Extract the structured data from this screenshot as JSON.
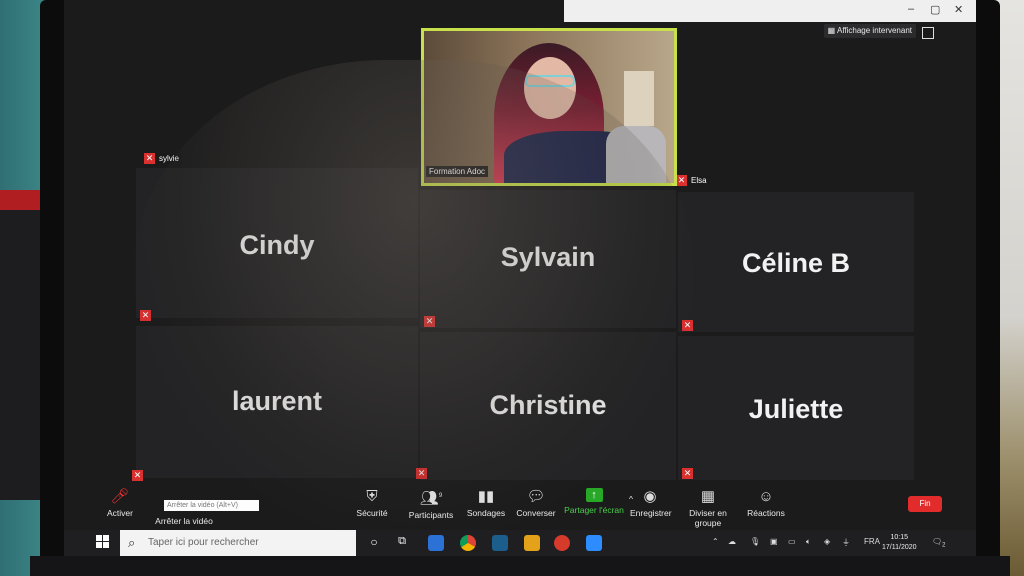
{
  "window": {
    "speaker_view_label": "Affichage intervenant",
    "controls": [
      "–",
      "▢",
      "✕"
    ]
  },
  "video_tile": {
    "name_label": "Formation Adoc",
    "top_left_label": "sylvie",
    "top_right_label": "Elsa"
  },
  "participants": [
    {
      "name": "Cindy",
      "muted": true
    },
    {
      "name": "Sylvain",
      "muted": true
    },
    {
      "name": "Céline B",
      "muted": true
    },
    {
      "name": "laurent",
      "muted": true
    },
    {
      "name": "Christine",
      "muted": true
    },
    {
      "name": "Juliette",
      "muted": true
    }
  ],
  "toolbar": {
    "video_label": "Activer",
    "video_stop_label": "Arrêter la vidéo",
    "tooltip": "Arrêter la vidéo (Alt+V)",
    "security": "Sécurité",
    "participants": "Participants",
    "participants_count": "9",
    "polls": "Sondages",
    "chat": "Converser",
    "share": "Partager l'écran",
    "record": "Enregistrer",
    "breakout": "Diviser en groupe",
    "reactions": "Réactions",
    "end": "Fin"
  },
  "taskbar": {
    "search_placeholder": "Taper ici pour rechercher",
    "language": "FRA",
    "time": "10:15",
    "date": "17/11/2020",
    "notification_count": "2"
  },
  "colors": {
    "active_speaker_border": "#c8e04a",
    "share_green": "#27a827",
    "end_red": "#e22b2b",
    "mute_red": "#d93030"
  }
}
